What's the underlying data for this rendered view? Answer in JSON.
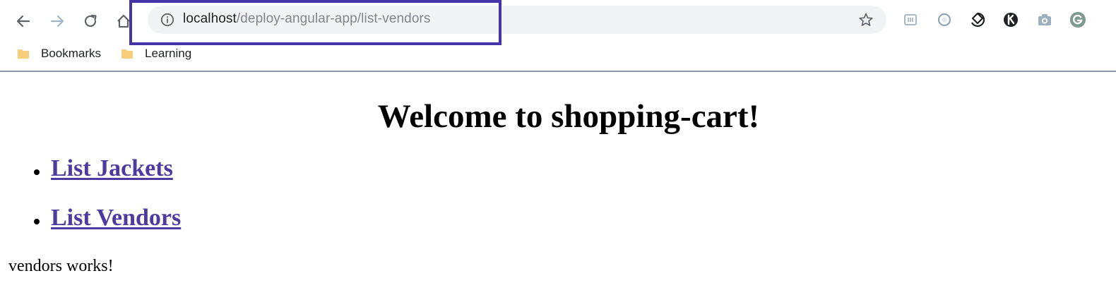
{
  "browser": {
    "address_bar": {
      "host": "localhost",
      "path": "/deploy-angular-app/list-vendors"
    },
    "bookmarks": [
      {
        "label": "Bookmarks"
      },
      {
        "label": "Learning"
      }
    ],
    "highlight_color": "#4334a8",
    "extensions": [
      "extension-icon",
      "extension-icon",
      "extension-icon",
      "extension-icon",
      "camera-icon",
      "profile-avatar"
    ]
  },
  "page": {
    "title": "Welcome to shopping-cart!",
    "nav": [
      {
        "label": "List Jackets"
      },
      {
        "label": "List Vendors"
      }
    ],
    "link_color": "#4c3aa0",
    "status_text": "vendors works!"
  }
}
